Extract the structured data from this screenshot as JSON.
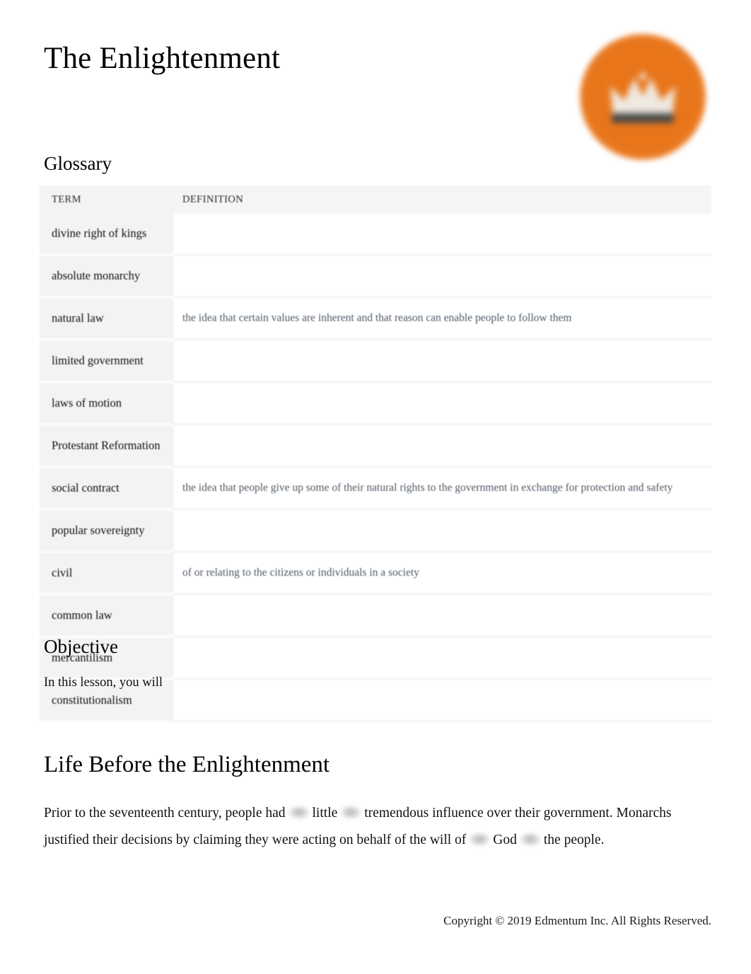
{
  "document": {
    "title": "The Enlightenment",
    "logo_icon": "crown-logo-icon",
    "logo_color": "#e8751a"
  },
  "glossary": {
    "heading": "Glossary",
    "columns": [
      "TERM",
      "DEFINITION"
    ],
    "rows": [
      {
        "term": "divine right of kings",
        "definition": ""
      },
      {
        "term": "absolute monarchy",
        "definition": ""
      },
      {
        "term": "natural law",
        "definition": "the idea that certain values are inherent and that reason can enable people to follow them"
      },
      {
        "term": "limited government",
        "definition": ""
      },
      {
        "term": "laws of motion",
        "definition": ""
      },
      {
        "term": "Protestant Reformation",
        "definition": ""
      },
      {
        "term": "social contract",
        "definition": "the idea that people give up some of their natural rights to the government in exchange for protection and safety"
      },
      {
        "term": "popular sovereignty",
        "definition": ""
      },
      {
        "term": "civil",
        "definition": "of or relating to the citizens or individuals in a society"
      },
      {
        "term": "common law",
        "definition": ""
      },
      {
        "term": "mercantilism",
        "definition": ""
      },
      {
        "term": "constitutionalism",
        "definition": ""
      }
    ]
  },
  "objective": {
    "heading": "Objective",
    "text": "In this lesson, you will"
  },
  "life_section": {
    "heading": "Life Before the Enlightenment",
    "paragraph_parts": {
      "p1": "Prior to the seventeenth century, people had",
      "p2": "little",
      "p3": "tremendous influence over their government. Monarchs justified their decisions by claiming they were acting on behalf of the will of",
      "p4": "God",
      "p5": "the people."
    }
  },
  "footer": {
    "copyright": "Copyright © 2019 Edmentum Inc. All Rights Reserved."
  }
}
